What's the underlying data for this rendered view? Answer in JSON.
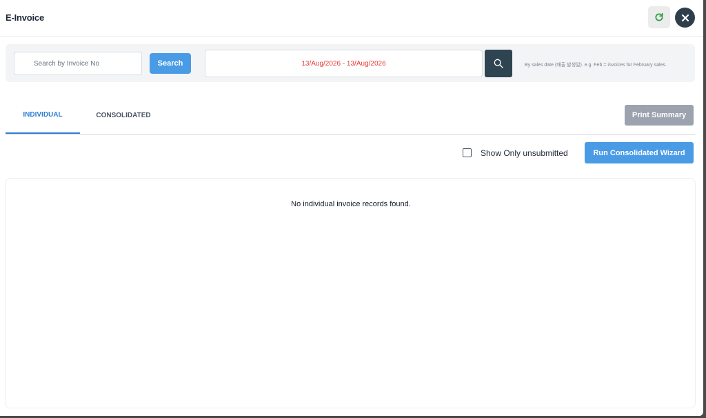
{
  "header": {
    "title": "E-Invoice",
    "refresh_icon": "refresh-icon",
    "close_icon": "close-icon",
    "refresh_color": "#2e9e44"
  },
  "filters": {
    "search_placeholder": "Search by Invoice No",
    "search_value": "",
    "search_button_label": "Search",
    "date_range": "13/Aug/2026 - 13/Aug/2026",
    "date_search_icon": "search-icon",
    "date_hint": "By sales date (매출 발생일). e.g. Feb = invoices for February sales."
  },
  "tabs": [
    {
      "label": "INDIVIDUAL",
      "active": true
    },
    {
      "label": "CONSOLIDATED",
      "active": false
    }
  ],
  "print_summary_label": "Print Summary",
  "toolbar": {
    "checkbox_label": "Show Only unsubmitted",
    "checkbox_checked": false,
    "wizard_button_label": "Run Consolidated Wizard"
  },
  "content": {
    "empty_message": "No individual invoice records found."
  },
  "colors": {
    "accent": "#4a9be6",
    "tab_active": "#2d7fd3",
    "date_text": "#e53935",
    "dark_button": "#2f4451"
  }
}
